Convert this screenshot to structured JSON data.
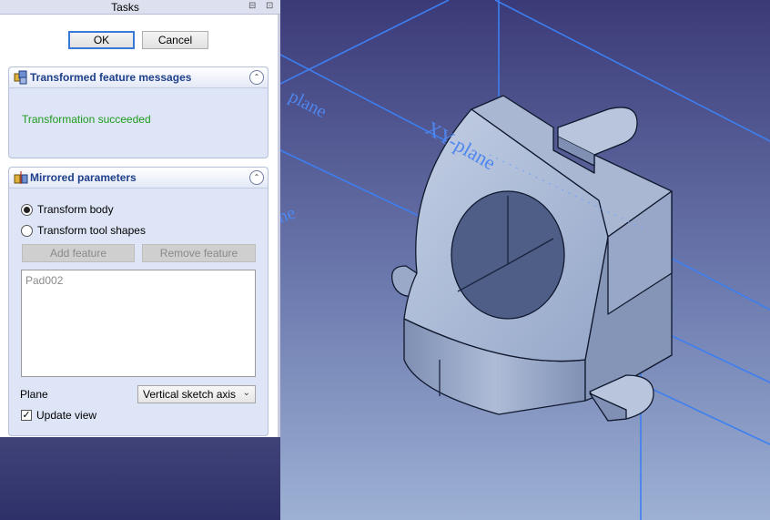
{
  "tasks": {
    "title": "Tasks",
    "ok_label": "OK",
    "cancel_label": "Cancel"
  },
  "messages_panel": {
    "title": "Transformed feature messages",
    "message": "Transformation succeeded"
  },
  "mirrored_panel": {
    "title": "Mirrored parameters",
    "radio_transform_body": "Transform body",
    "radio_transform_tool": "Transform tool shapes",
    "selected_mode": "Transform body",
    "add_feature_label": "Add feature",
    "remove_feature_label": "Remove feature",
    "features": [
      "Pad002"
    ],
    "plane_label": "Plane",
    "plane_value": "Vertical sketch axis",
    "update_view_label": "Update view",
    "update_view_checked": true
  },
  "viewport": {
    "plane_labels": [
      "XY-plane",
      "plane",
      "ne"
    ]
  },
  "colors": {
    "success_green": "#1f9a1f",
    "viewport_top": "#3b3a78",
    "viewport_bottom": "#9db1d4",
    "plane_blue": "#3d7ff0",
    "part_face": "#b5c3dc"
  }
}
